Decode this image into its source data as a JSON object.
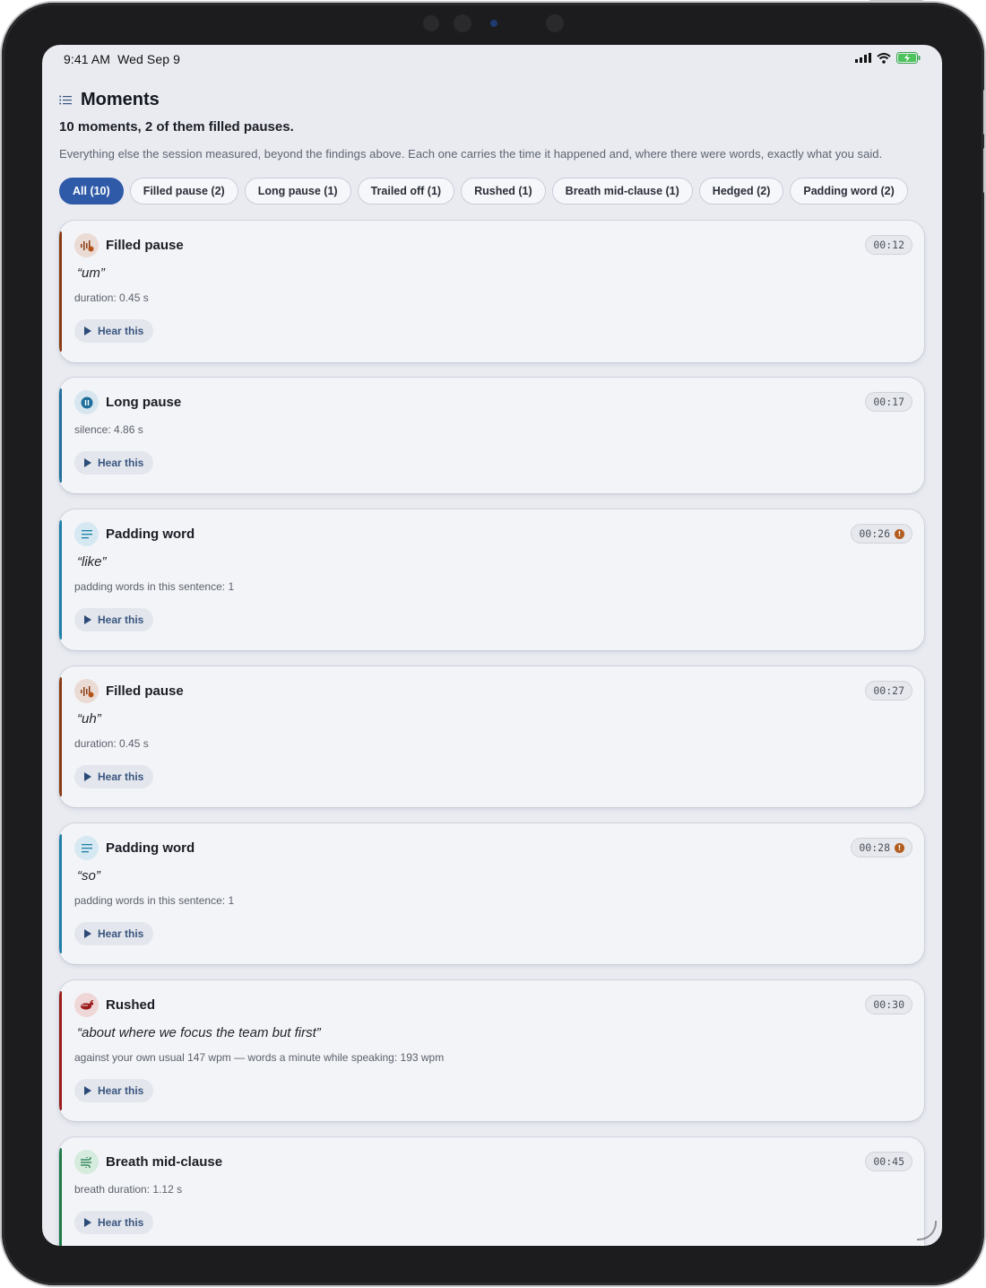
{
  "status": {
    "time": "9:41 AM",
    "date": "Wed Sep 9"
  },
  "header": {
    "title": "Moments",
    "subtitle": "10 moments, 2 of them filled pauses.",
    "description": "Everything else the session measured, beyond the findings above. Each one carries the time it happened and, where there were words, exactly what you said."
  },
  "filters": [
    {
      "label": "All (10)",
      "active": true
    },
    {
      "label": "Filled pause (2)"
    },
    {
      "label": "Long pause (1)"
    },
    {
      "label": "Trailed off (1)"
    },
    {
      "label": "Rushed (1)"
    },
    {
      "label": "Breath mid-clause (1)"
    },
    {
      "label": "Hedged (2)"
    },
    {
      "label": "Padding word (2)"
    }
  ],
  "hear_label": "Hear this",
  "moments": [
    {
      "title": "Filled pause",
      "time": "00:12",
      "quote": "“um”",
      "meta": "duration: 0.45 s",
      "color": "#8a3b12",
      "icon": "waveform-icon"
    },
    {
      "title": "Long pause",
      "time": "00:17",
      "meta": "silence: 4.86 s",
      "color": "#1f6f9a",
      "icon": "pause-icon"
    },
    {
      "title": "Padding word",
      "time": "00:26",
      "quote": "“like”",
      "meta": "padding words in this sentence: 1",
      "color": "#1f7fa8",
      "icon": "lines-icon",
      "flag": true
    },
    {
      "title": "Filled pause",
      "time": "00:27",
      "quote": "“uh”",
      "meta": "duration: 0.45 s",
      "color": "#8a3b12",
      "icon": "waveform-icon"
    },
    {
      "title": "Padding word",
      "time": "00:28",
      "quote": "“so”",
      "meta": "padding words in this sentence: 1",
      "color": "#1f7fa8",
      "icon": "lines-icon",
      "flag": true
    },
    {
      "title": "Rushed",
      "time": "00:30",
      "quote": "“about where we focus the team but first”",
      "meta": "against your own usual 147 wpm — words a minute while speaking: 193 wpm",
      "color": "#9b1b1b",
      "icon": "rabbit-icon"
    },
    {
      "title": "Breath mid-clause",
      "time": "00:45",
      "meta": "breath duration: 1.12 s",
      "color": "#1f7a4a",
      "icon": "wind-icon"
    }
  ]
}
